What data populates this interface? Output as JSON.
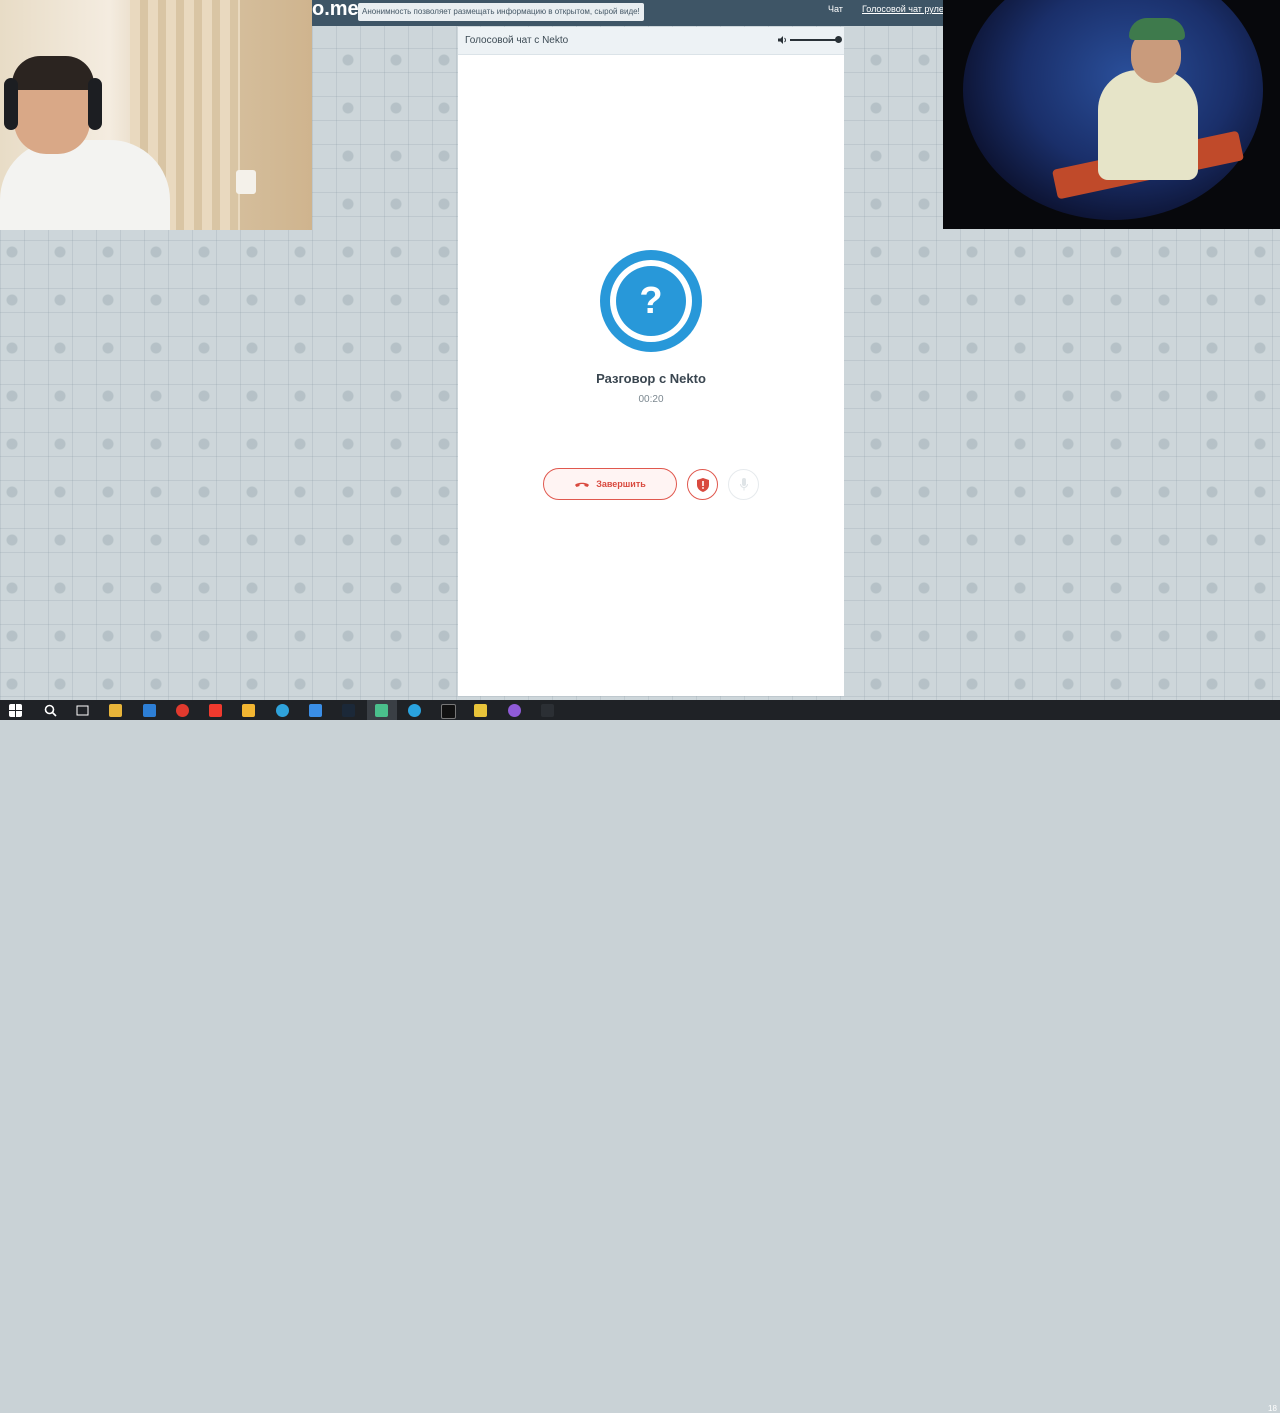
{
  "site": {
    "logo": "o.me",
    "notice": "Анонимность позволяет размещать информацию в открытом, сырой виде!",
    "nav": {
      "chat": "Чат",
      "voice_roulette": "Голосовой чат рулет"
    }
  },
  "panel": {
    "title": "Голосовой чат с Nekto",
    "volume_level": 1.0
  },
  "call": {
    "avatar_symbol": "?",
    "title": "Разговор с Nekto",
    "timer": "00:20",
    "end_label": "Завершить"
  },
  "taskbar": {
    "clock": "18"
  },
  "colors": {
    "accent_blue": "#2898d9",
    "end_red": "#d94a3f",
    "topbar": "#3e5566"
  }
}
